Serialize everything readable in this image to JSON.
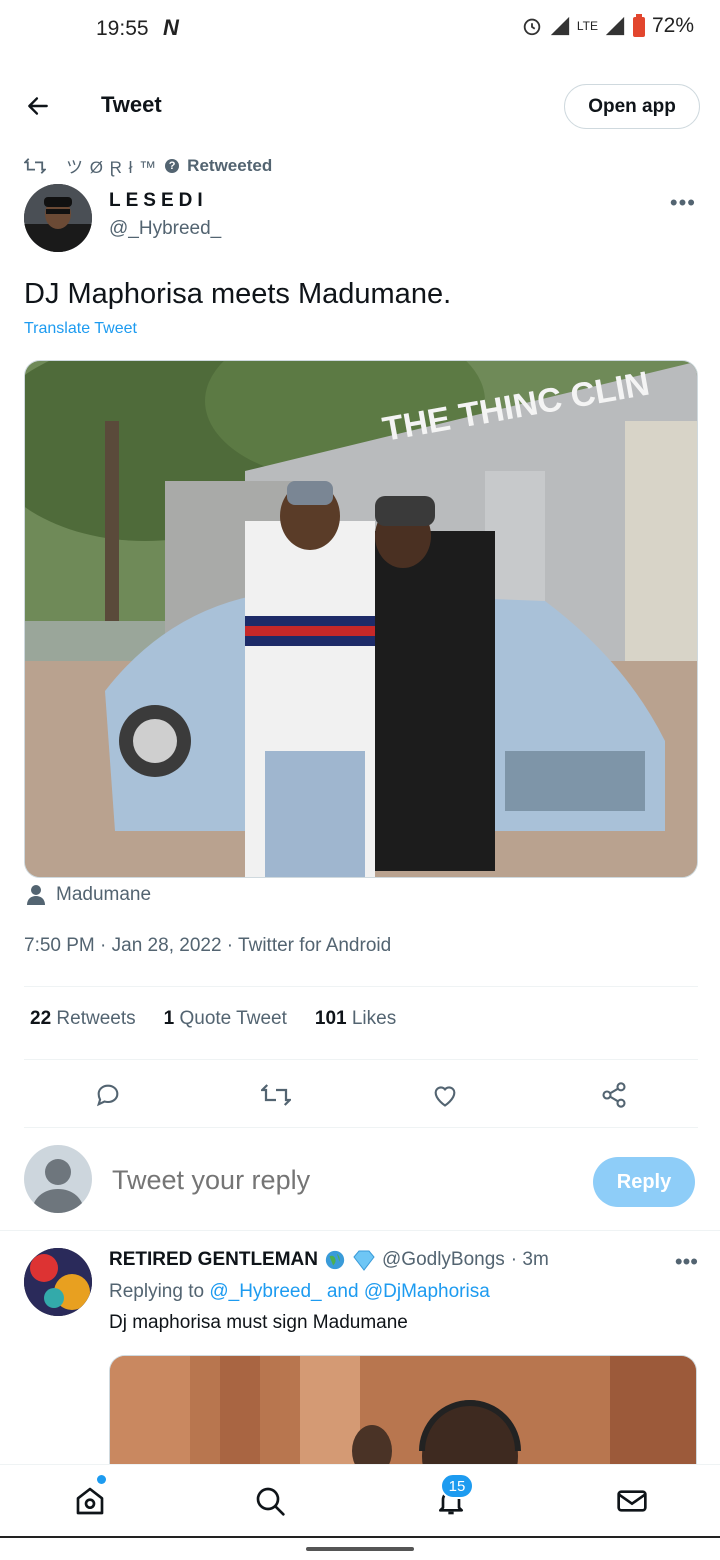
{
  "status_bar": {
    "time": "19:55",
    "battery": "72%",
    "network": "LTE"
  },
  "header": {
    "title": "Tweet",
    "open_app": "Open app"
  },
  "retweet": {
    "name": "ツ Ø Ɽ ł ™",
    "label": "Retweeted"
  },
  "tweet": {
    "author_name": "LESEDI",
    "author_handle": "@_Hybreed_",
    "text": "DJ Maphorisa meets Madumane.",
    "translate": "Translate Tweet",
    "tagged": "Madumane",
    "meta": "7:50 PM · Jan 28, 2022 · Twitter for Android",
    "stats": {
      "retweets_count": "22",
      "retweets_label": "Retweets",
      "quotes_count": "1",
      "quotes_label": "Quote Tweet",
      "likes_count": "101",
      "likes_label": "Likes"
    }
  },
  "composer": {
    "placeholder": "Tweet your reply",
    "reply_button": "Reply"
  },
  "reply": {
    "name": "RETIRED GENTLEMAN",
    "handle": "@GodlyBongs",
    "time": "· 3m",
    "replying_prefix": "Replying to",
    "replying_to": "@_Hybreed_ and @DjMaphorisa",
    "text": "Dj maphorisa must sign Madumane"
  },
  "bottom_nav": {
    "notifications_badge": "15"
  },
  "colors": {
    "accent": "#1d9bf0",
    "muted": "#536471",
    "reply_button_disabled": "#8ecdf8"
  }
}
